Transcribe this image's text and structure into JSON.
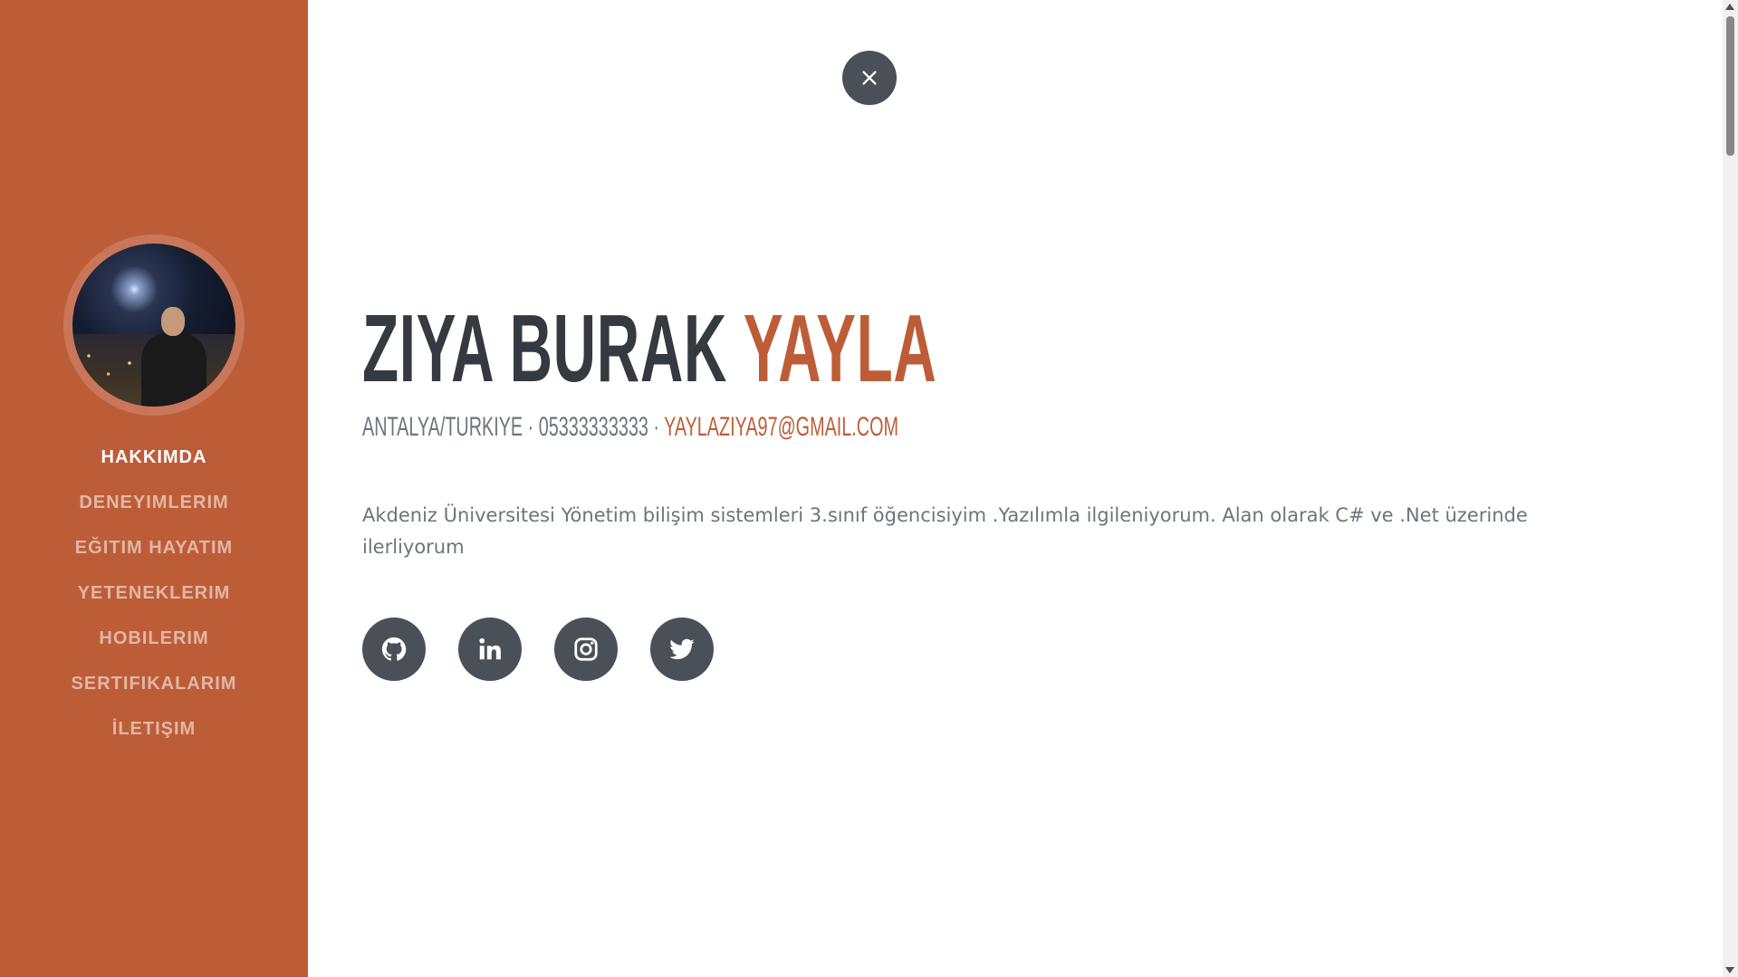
{
  "sidebar": {
    "avatar_alt": "profile photo",
    "nav": [
      {
        "label": "HAKKIMDA",
        "active": true
      },
      {
        "label": "DENEYIMLERIM",
        "active": false
      },
      {
        "label": "EĞITIM HAYATIM",
        "active": false
      },
      {
        "label": "YETENEKLERIM",
        "active": false
      },
      {
        "label": "HOBILERIM",
        "active": false
      },
      {
        "label": "SERTIFIKALARIM",
        "active": false
      },
      {
        "label": "İLETIŞIM",
        "active": false
      }
    ]
  },
  "close_button": {
    "icon": "close-icon"
  },
  "about": {
    "first_name": "ZIYA BURAK",
    "last_name": "YAYLA",
    "location": "ANTALYA/TURKIYE",
    "separator": " · ",
    "phone": "05333333333",
    "email": "YAYLAZIYA97@GMAIL.COM",
    "lead": "Akdeniz Üniversitesi Yönetim bilişim sistemleri 3.sınıf öğencisiyim .Yazılımla ilgileniyorum. Alan olarak C# ve .Net üzerinde ilerliyorum"
  },
  "social": [
    {
      "name": "github-icon"
    },
    {
      "name": "linkedin-icon"
    },
    {
      "name": "instagram-icon"
    },
    {
      "name": "twitter-icon"
    }
  ],
  "colors": {
    "primary": "#bd5d38",
    "dark": "#343a40",
    "muted": "#6c757d",
    "icon_bg": "#495057"
  }
}
